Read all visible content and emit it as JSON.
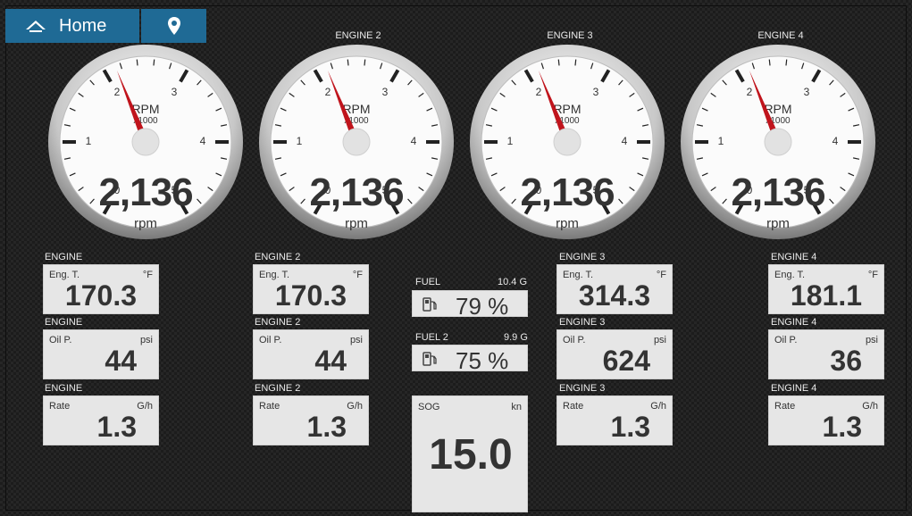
{
  "nav": {
    "home_label": "Home",
    "home_icon": "home-icon",
    "location_icon": "location-pin-icon"
  },
  "gauges": [
    {
      "title": "",
      "value": "2,136",
      "unit": "rpm",
      "rpm_label": "RPM",
      "multiplier": "x1000"
    },
    {
      "title": "ENGINE 2",
      "value": "2,136",
      "unit": "rpm",
      "rpm_label": "RPM",
      "multiplier": "x1000"
    },
    {
      "title": "ENGINE 3",
      "value": "2,136",
      "unit": "rpm",
      "rpm_label": "RPM",
      "multiplier": "x1000"
    },
    {
      "title": "ENGINE 4",
      "value": "2,136",
      "unit": "rpm",
      "rpm_label": "RPM",
      "multiplier": "x1000"
    }
  ],
  "gauge_scale": {
    "ticks": [
      "0",
      "1",
      "2",
      "3",
      "4",
      "5"
    ],
    "needle_value": 2.136,
    "min": 0,
    "max": 5
  },
  "columns": [
    {
      "rows": [
        {
          "label": "ENGINE",
          "name": "Eng. T.",
          "unit": "°F",
          "value": "170.3"
        },
        {
          "label": "ENGINE",
          "name": "Oil P.",
          "unit": "psi",
          "value": "44"
        },
        {
          "label": "ENGINE",
          "name": "Rate",
          "unit": "G/h",
          "value": "1.3"
        }
      ]
    },
    {
      "rows": [
        {
          "label": "ENGINE 2",
          "name": "Eng. T.",
          "unit": "°F",
          "value": "170.3"
        },
        {
          "label": "ENGINE 2",
          "name": "Oil P.",
          "unit": "psi",
          "value": "44"
        },
        {
          "label": "ENGINE 2",
          "name": "Rate",
          "unit": "G/h",
          "value": "1.3"
        }
      ]
    },
    {
      "rows": [
        {
          "label": "ENGINE 3",
          "name": "Eng. T.",
          "unit": "°F",
          "value": "314.3"
        },
        {
          "label": "ENGINE 3",
          "name": "Oil P.",
          "unit": "psi",
          "value": "624"
        },
        {
          "label": "ENGINE 3",
          "name": "Rate",
          "unit": "G/h",
          "value": "1.3"
        }
      ]
    },
    {
      "rows": [
        {
          "label": "ENGINE 4",
          "name": "Eng. T.",
          "unit": "°F",
          "value": "181.1"
        },
        {
          "label": "ENGINE 4",
          "name": "Oil P.",
          "unit": "psi",
          "value": "36"
        },
        {
          "label": "ENGINE 4",
          "name": "Rate",
          "unit": "G/h",
          "value": "1.3"
        }
      ]
    }
  ],
  "fuel": [
    {
      "label": "FUEL",
      "capacity": "10.4 G",
      "percent": "79 %",
      "icon": "fuel-pump-icon"
    },
    {
      "label": "FUEL 2",
      "capacity": "9.9 G",
      "percent": "75 %",
      "icon": "fuel-pump-icon"
    }
  ],
  "sog": {
    "name": "SOG",
    "unit": "kn",
    "value": "15.0"
  },
  "colors": {
    "nav_blue": "#1f6a95",
    "needle": "#c0141c",
    "panel": "#e6e6e6"
  }
}
